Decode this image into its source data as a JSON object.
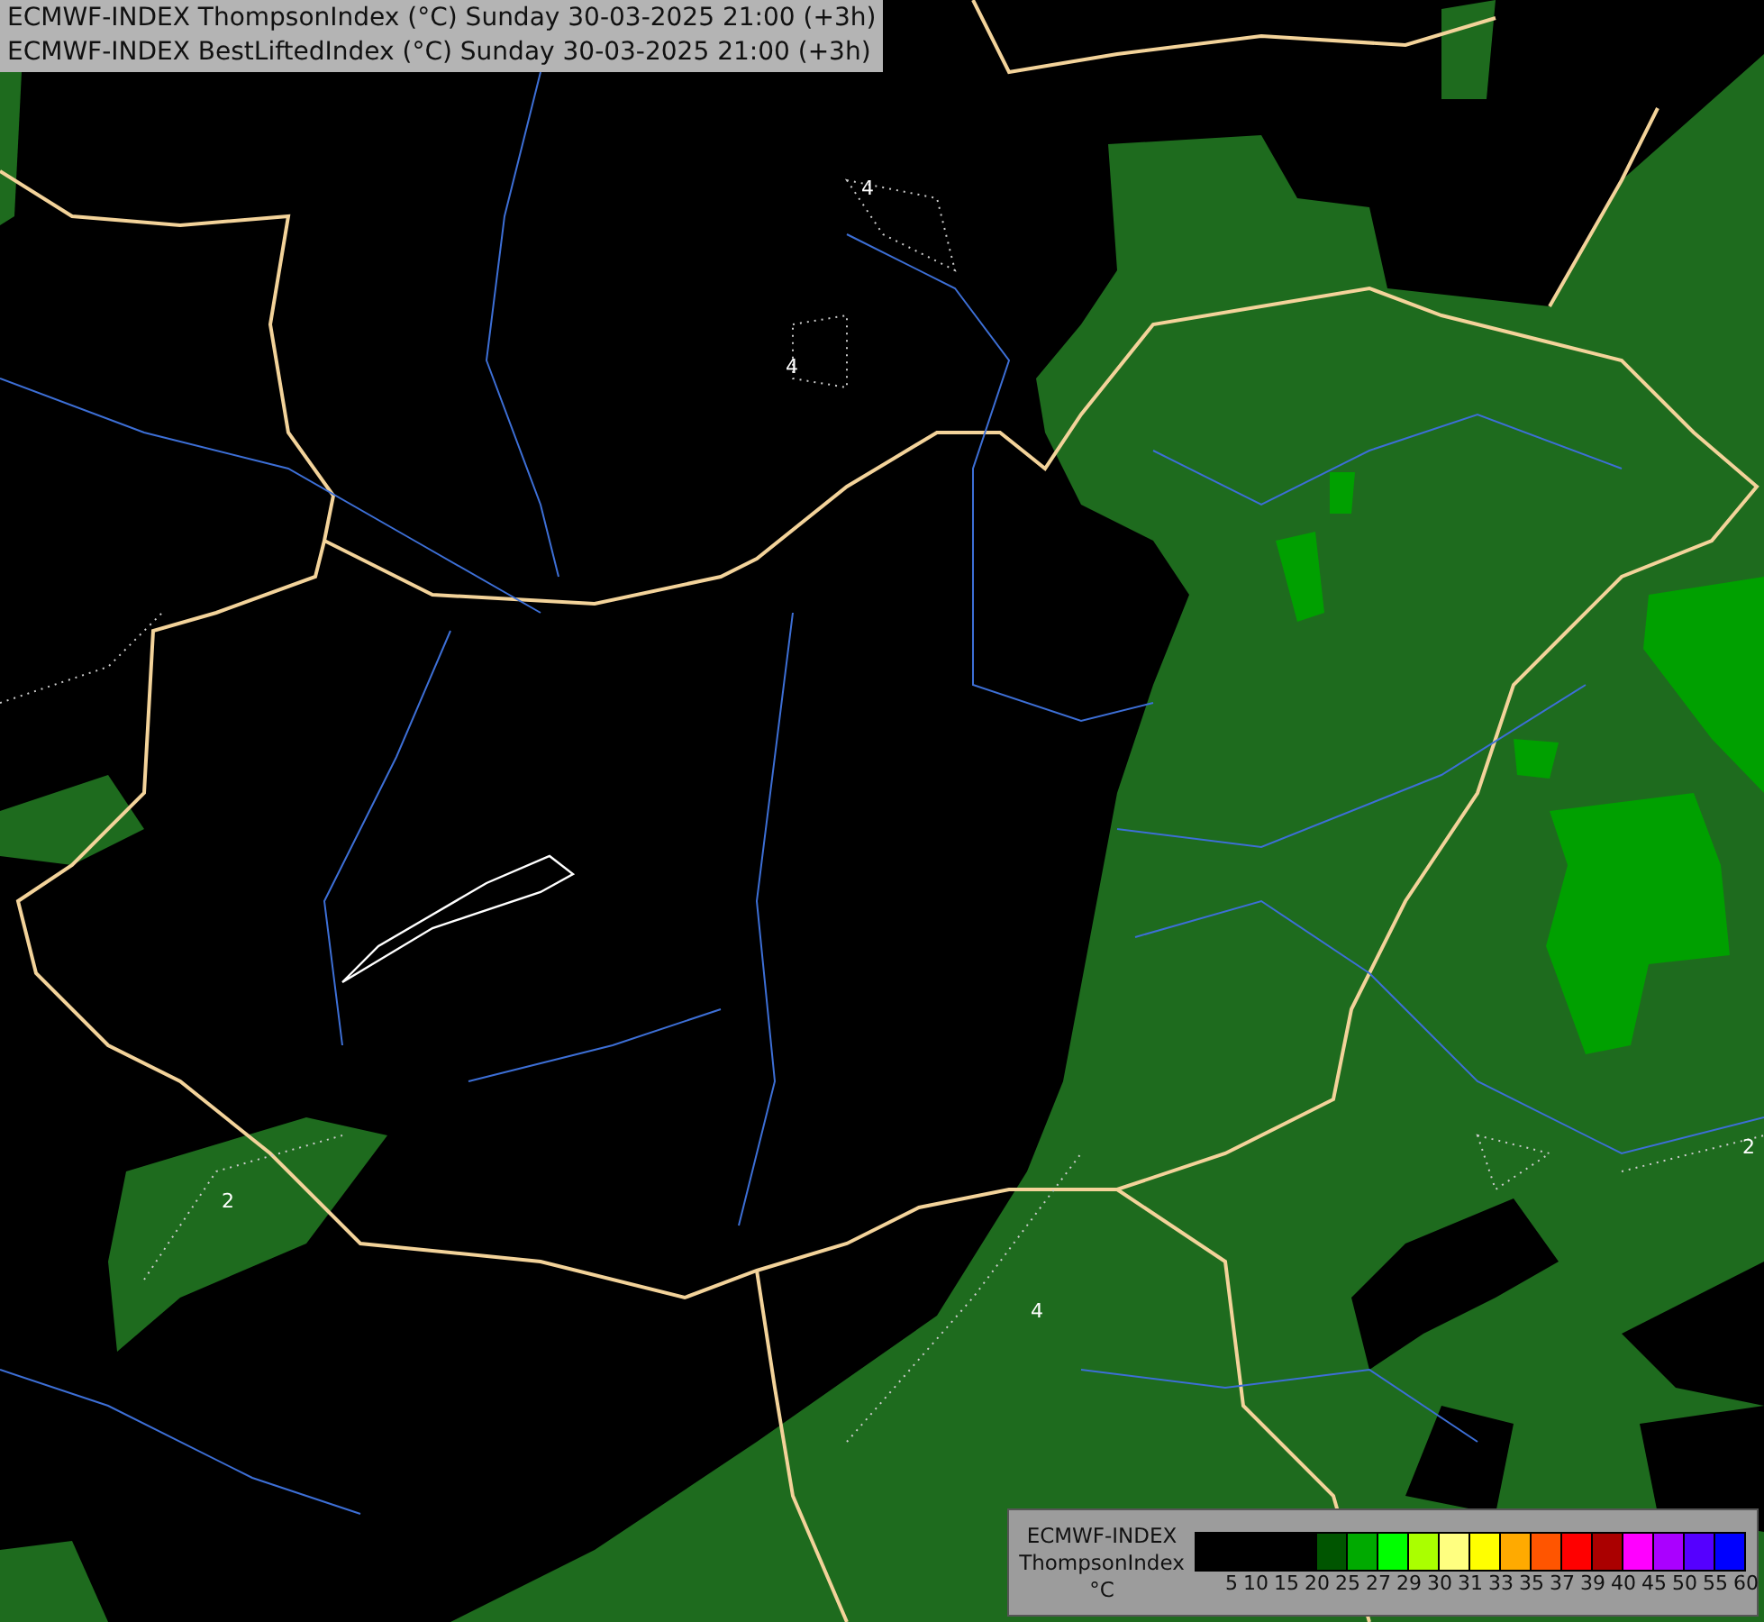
{
  "header": {
    "lines": [
      "ECMWF-INDEX ThompsonIndex (°C) Sunday 30-03-2025 21:00 (+3h)",
      "ECMWF-INDEX BestLiftedIndex (°C) Sunday 30-03-2025 21:00 (+3h)"
    ]
  },
  "map": {
    "contour_labels": [
      "4",
      "4",
      "2",
      "4",
      "2"
    ]
  },
  "legend": {
    "title_lines": [
      "ECMWF-INDEX",
      "ThompsonIndex",
      "°C"
    ],
    "bins": [
      {
        "color": "#000000",
        "label": "5"
      },
      {
        "color": "#000000",
        "label": "10"
      },
      {
        "color": "#000000",
        "label": "15"
      },
      {
        "color": "#000000",
        "label": "20"
      },
      {
        "color": "#005500",
        "label": "25"
      },
      {
        "color": "#00aa00",
        "label": "27"
      },
      {
        "color": "#00ff00",
        "label": "29"
      },
      {
        "color": "#aaff00",
        "label": "30"
      },
      {
        "color": "#ffff80",
        "label": "31"
      },
      {
        "color": "#ffff00",
        "label": "33"
      },
      {
        "color": "#ffaa00",
        "label": "35"
      },
      {
        "color": "#ff5500",
        "label": "37"
      },
      {
        "color": "#ff0000",
        "label": "39"
      },
      {
        "color": "#aa0000",
        "label": "40"
      },
      {
        "color": "#ff00ff",
        "label": "45"
      },
      {
        "color": "#aa00ff",
        "label": "50"
      },
      {
        "color": "#5500ff",
        "label": "55"
      },
      {
        "color": "#0000ff",
        "label": "60"
      }
    ]
  }
}
